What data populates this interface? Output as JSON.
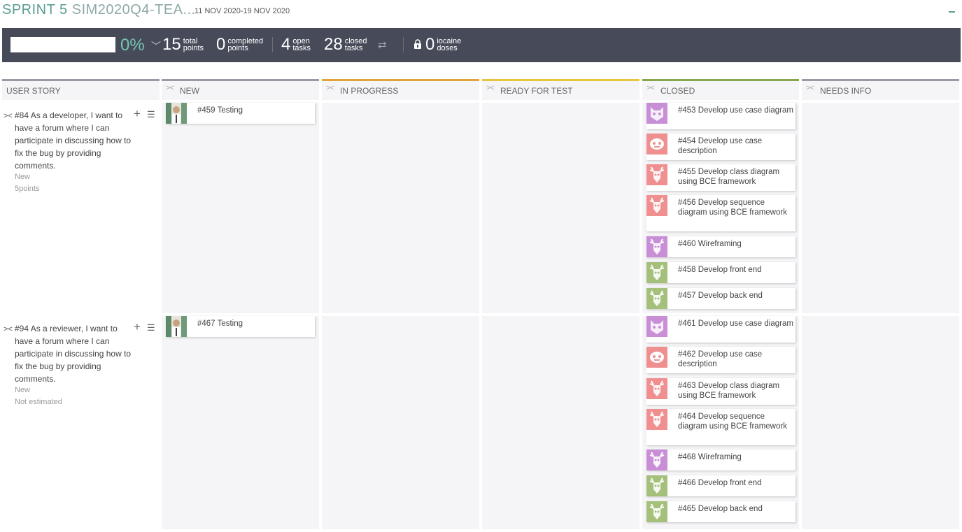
{
  "header": {
    "sprint_label": "SPRINT 5",
    "project": "SIM2020Q4-TEA...",
    "dates": "11 NOV 2020-19 NOV 2020"
  },
  "stats": {
    "progress_percent": "0%",
    "total_points": {
      "value": "15",
      "label_1": "total",
      "label_2": "points"
    },
    "completed_points": {
      "value": "0",
      "label_1": "completed",
      "label_2": "points"
    },
    "open_tasks": {
      "value": "4",
      "label_1": "open",
      "label_2": "tasks"
    },
    "closed_tasks": {
      "value": "28",
      "label_1": "closed",
      "label_2": "tasks"
    },
    "iocaine": {
      "value": "0",
      "label_1": "iocaine",
      "label_2": "doses"
    }
  },
  "columns": {
    "user_story": "USER STORY",
    "new": "NEW",
    "in_progress": "IN PROGRESS",
    "ready_for_test": "READY FOR TEST",
    "closed": "CLOSED",
    "needs_info": "NEEDS INFO"
  },
  "colors": {
    "new": "#9a9aa5",
    "in_progress": "#e3a33b",
    "ready_for_test": "#e6c63a",
    "closed": "#86a84c",
    "needs_info": "#9a9aa5",
    "accent": "#5b9e95",
    "stats_bg": "#474b59"
  },
  "stories": [
    {
      "text": "#84 As a developer, I want to have a forum where I can participate in discussing how to fix the bug by providing comments.",
      "status": "New",
      "points": "5points",
      "new_tasks": [
        {
          "label": "#459 Testing",
          "avatar": "photo"
        }
      ],
      "closed_tasks": [
        {
          "label": "#453 Develop use case diagram",
          "avatar": "purple-cat"
        },
        {
          "label": "#454 Develop use case description",
          "avatar": "pink-face"
        },
        {
          "label": "#455 Develop class diagram using BCE framework",
          "avatar": "pink-deer"
        },
        {
          "label": "#456 Develop sequence diagram using BCE framework",
          "avatar": "pink-deer"
        },
        {
          "label": "#460 Wireframing",
          "avatar": "purple-deer"
        },
        {
          "label": "#458 Develop front end",
          "avatar": "green-deer"
        },
        {
          "label": "#457 Develop back end",
          "avatar": "green-deer"
        }
      ]
    },
    {
      "text": "#94 As a reviewer, I want to have a forum where I can participate in discussing how to fix the bug by providing comments.",
      "status": "New",
      "points": "Not estimated",
      "new_tasks": [
        {
          "label": "#467 Testing",
          "avatar": "photo"
        }
      ],
      "closed_tasks": [
        {
          "label": "#461 Develop use case diagram",
          "avatar": "purple-cat"
        },
        {
          "label": "#462 Develop use case description",
          "avatar": "pink-face"
        },
        {
          "label": "#463 Develop class diagram using BCE framework",
          "avatar": "pink-deer"
        },
        {
          "label": "#464 Develop sequence diagram using BCE framework",
          "avatar": "pink-deer"
        },
        {
          "label": "#468 Wireframing",
          "avatar": "purple-deer"
        },
        {
          "label": "#466 Develop front end",
          "avatar": "green-deer"
        },
        {
          "label": "#465 Develop back end",
          "avatar": "green-deer"
        }
      ]
    }
  ]
}
